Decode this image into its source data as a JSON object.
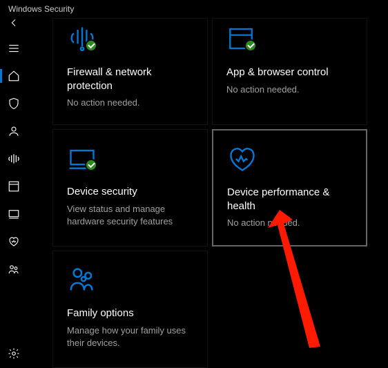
{
  "window": {
    "title": "Windows Security"
  },
  "nav": {
    "back": "back-icon",
    "items": [
      {
        "name": "menu-icon"
      },
      {
        "name": "home-icon",
        "selected": true
      },
      {
        "name": "shield-icon"
      },
      {
        "name": "person-icon"
      },
      {
        "name": "firewall-nav-icon"
      },
      {
        "name": "app-browser-nav-icon"
      },
      {
        "name": "device-nav-icon"
      },
      {
        "name": "heart-nav-icon"
      },
      {
        "name": "family-nav-icon"
      }
    ],
    "settings": "settings-icon"
  },
  "tiles": [
    {
      "id": "firewall",
      "title": "Firewall & network protection",
      "desc": "No action needed.",
      "badge": true
    },
    {
      "id": "appbrowser",
      "title": "App & browser control",
      "desc": "No action needed.",
      "badge": true
    },
    {
      "id": "devicesec",
      "title": "Device security",
      "desc": "View status and manage hardware security features",
      "badge": true
    },
    {
      "id": "perfhealth",
      "title": "Device performance & health",
      "desc": "No action needed.",
      "selected": true
    },
    {
      "id": "family",
      "title": "Family options",
      "desc": "Manage how your family uses their devices."
    }
  ],
  "annotation": {
    "type": "arrow",
    "color": "#ff1a00"
  }
}
